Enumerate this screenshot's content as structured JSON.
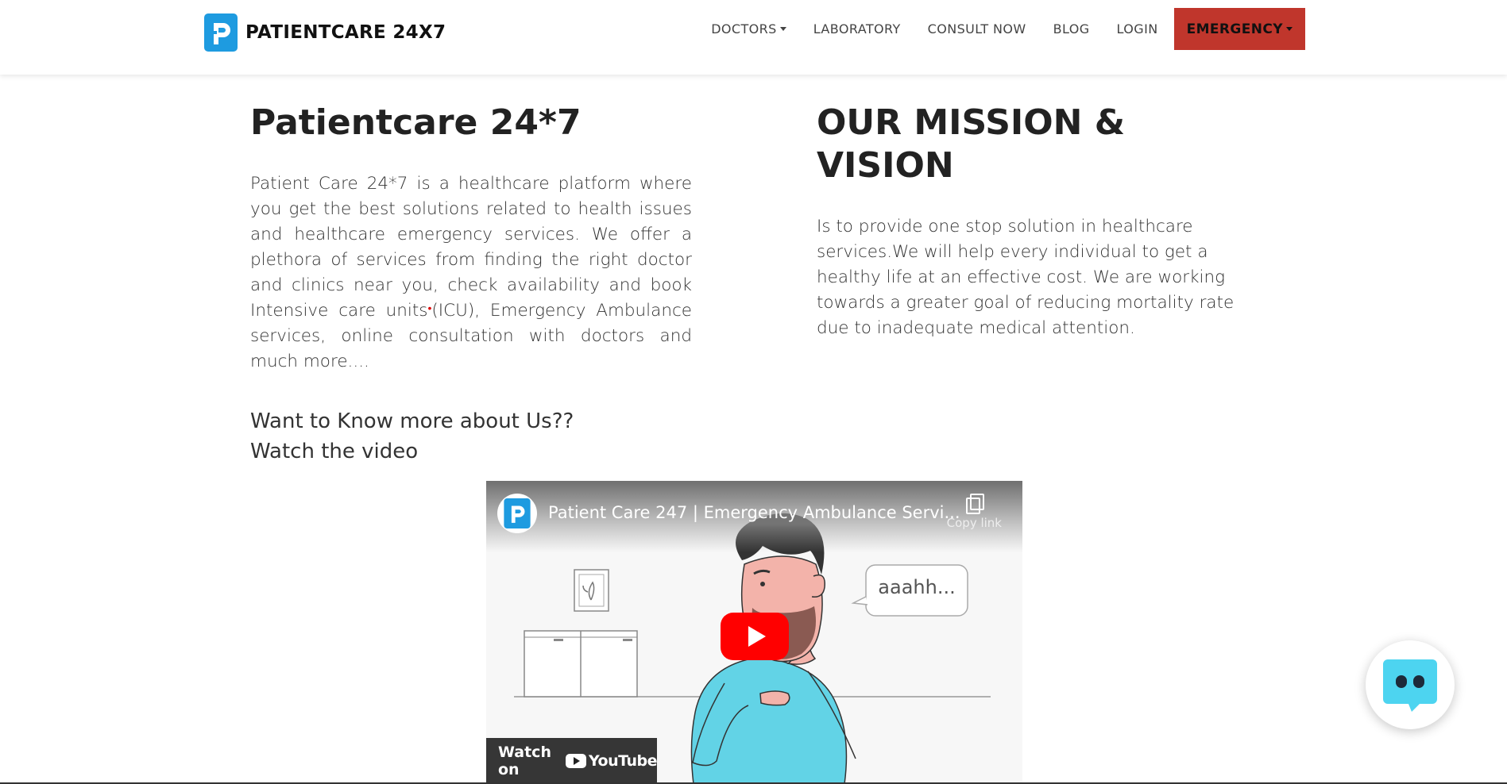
{
  "brand": {
    "name": "PATIENTCARE 24X7",
    "logo_icon": "patientcare-logo-icon"
  },
  "nav": {
    "items": [
      {
        "label": "DOCTORS",
        "dropdown": true
      },
      {
        "label": "LABORATORY",
        "dropdown": false
      },
      {
        "label": "CONSULT NOW",
        "dropdown": false
      },
      {
        "label": "BLOG",
        "dropdown": false
      },
      {
        "label": "LOGIN",
        "dropdown": false
      }
    ],
    "emergency": {
      "label": "EMERGENCY",
      "color": "#c0362c"
    }
  },
  "about": {
    "title": "Patientcare 24*7",
    "text_before": "Patient Care 24*7 is a healthcare platform where you get the best solutions related to health issues and healthcare emergency services. We offer a plethora of services from finding the right doctor and clinics near you, check availability and book Intensive care units",
    "text_after": "(ICU), Emergency Ambulance services, online consultation with doctors and much more....",
    "cta_line1": "Want to Know more about Us??",
    "cta_line2": "Watch the video"
  },
  "mission": {
    "title": "OUR MISSION & VISION",
    "text": "Is to provide one stop solution in healthcare services.We will help every individual to get a healthy life at an effective cost. We are working towards a greater goal of reducing mortality rate due to inadequate medical attention."
  },
  "video": {
    "title": "Patient Care 247 | Emergency Ambulance Servi...",
    "copy_link": "Copy link",
    "speech": "aaahh...",
    "watch_on": "Watch on",
    "youtube": "YouTube",
    "play_color": "#ff0000"
  },
  "chat": {
    "icon": "chatbot-icon",
    "color": "#4dd4f0"
  }
}
